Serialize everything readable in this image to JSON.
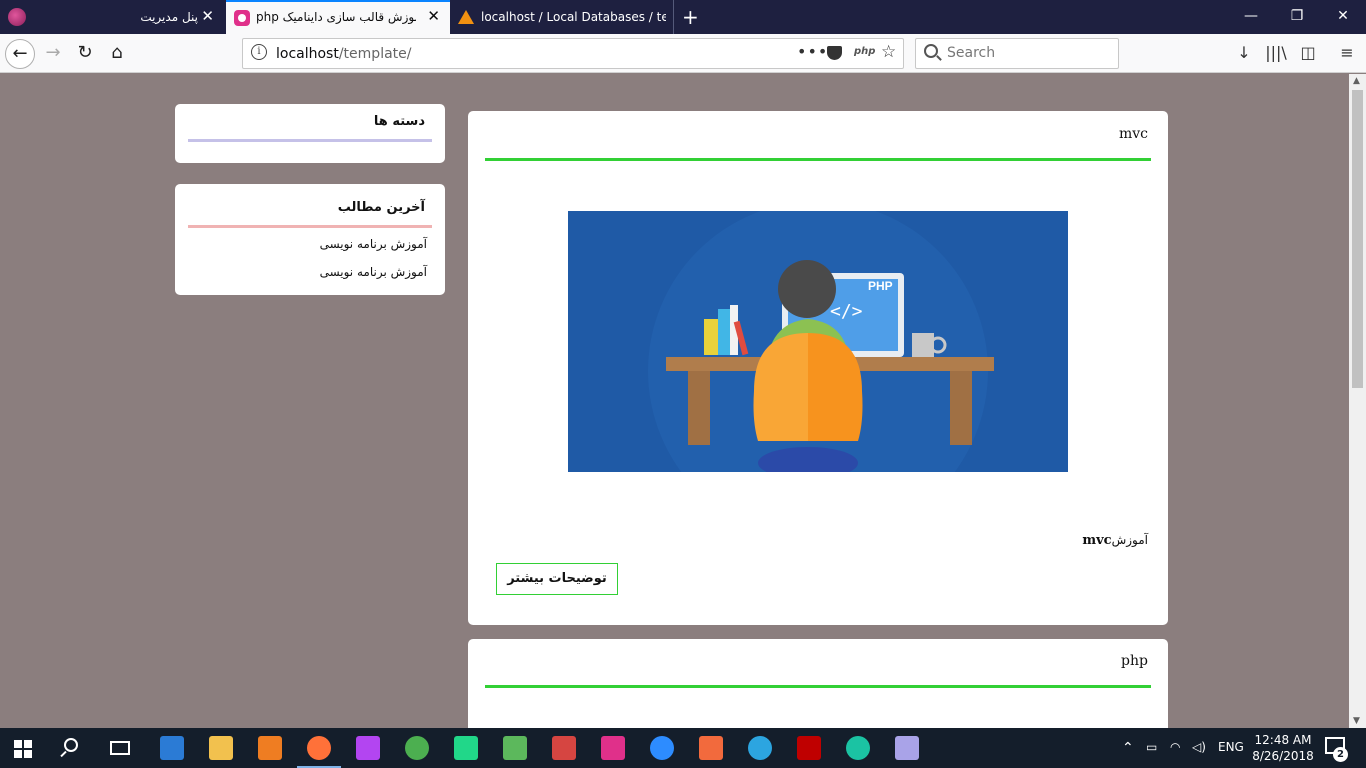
{
  "browser": {
    "tabs": [
      {
        "title": "پنل مدیریت"
      },
      {
        "title": "php آموزش قالب سازی داینامیک"
      },
      {
        "title": "localhost / Local Databases / te"
      }
    ],
    "new_tab": "+",
    "url_host": "localhost",
    "url_path": "/template/",
    "search_placeholder": "Search",
    "url_icons": {
      "info": "i",
      "more": "•••",
      "php": "php",
      "star": "☆"
    },
    "nav": {
      "back": "←",
      "forward": "→",
      "reload": "↻",
      "home": "⌂"
    },
    "tools": {
      "download": "↓",
      "library": "|||\\",
      "sidebar": "◫",
      "menu": "≡"
    },
    "window": {
      "minimize": "—",
      "maximize": "❐",
      "close": "✕"
    }
  },
  "sidebar": {
    "categories": {
      "title": "دسته ها"
    },
    "latest": {
      "title": "آخرین مطالب",
      "items": [
        "آموزش برنامه نویسی",
        "آموزش برنامه نویسی"
      ]
    }
  },
  "posts": [
    {
      "title": "mvc",
      "desc_prefix": "آموزش",
      "desc_bold": "mvc",
      "more_label": "توضیحات بیشتر",
      "image_badge": "PHP",
      "image_code": "</>"
    },
    {
      "title": "php"
    }
  ],
  "taskbar": {
    "apps": [
      "edge-icon",
      "explorer-icon",
      "sublime-icon",
      "firefox-icon",
      "phpstorm-icon",
      "chrome-icon",
      "webstorm-icon",
      "camtasia-icon",
      "pinterest-icon",
      "wamp-icon",
      "zoom-icon",
      "feather-icon",
      "telegram-icon",
      "filezilla-icon",
      "gitkraken-icon",
      "visualstudio-icon"
    ],
    "lang": "ENG",
    "time": "12:48 AM",
    "date": "8/26/2018",
    "notifications": "2",
    "colors": {
      "edge": "#2b7bd5",
      "explorer": "#f2c14e",
      "sublime": "#ef7d22",
      "firefox": "#ff7139",
      "phpstorm": "#b345f1",
      "chrome": "#4caf50",
      "webstorm": "#21d789",
      "camtasia": "#5cb85c",
      "pinterest": "#d64541",
      "wamp": "#e0308a",
      "zoom": "#2d8cff",
      "feather": "#f26a3d",
      "telegram": "#2ca5e0",
      "filezilla": "#bf0000",
      "gitkraken": "#1bc3a3",
      "visualstudio": "#a9a3e8"
    }
  }
}
